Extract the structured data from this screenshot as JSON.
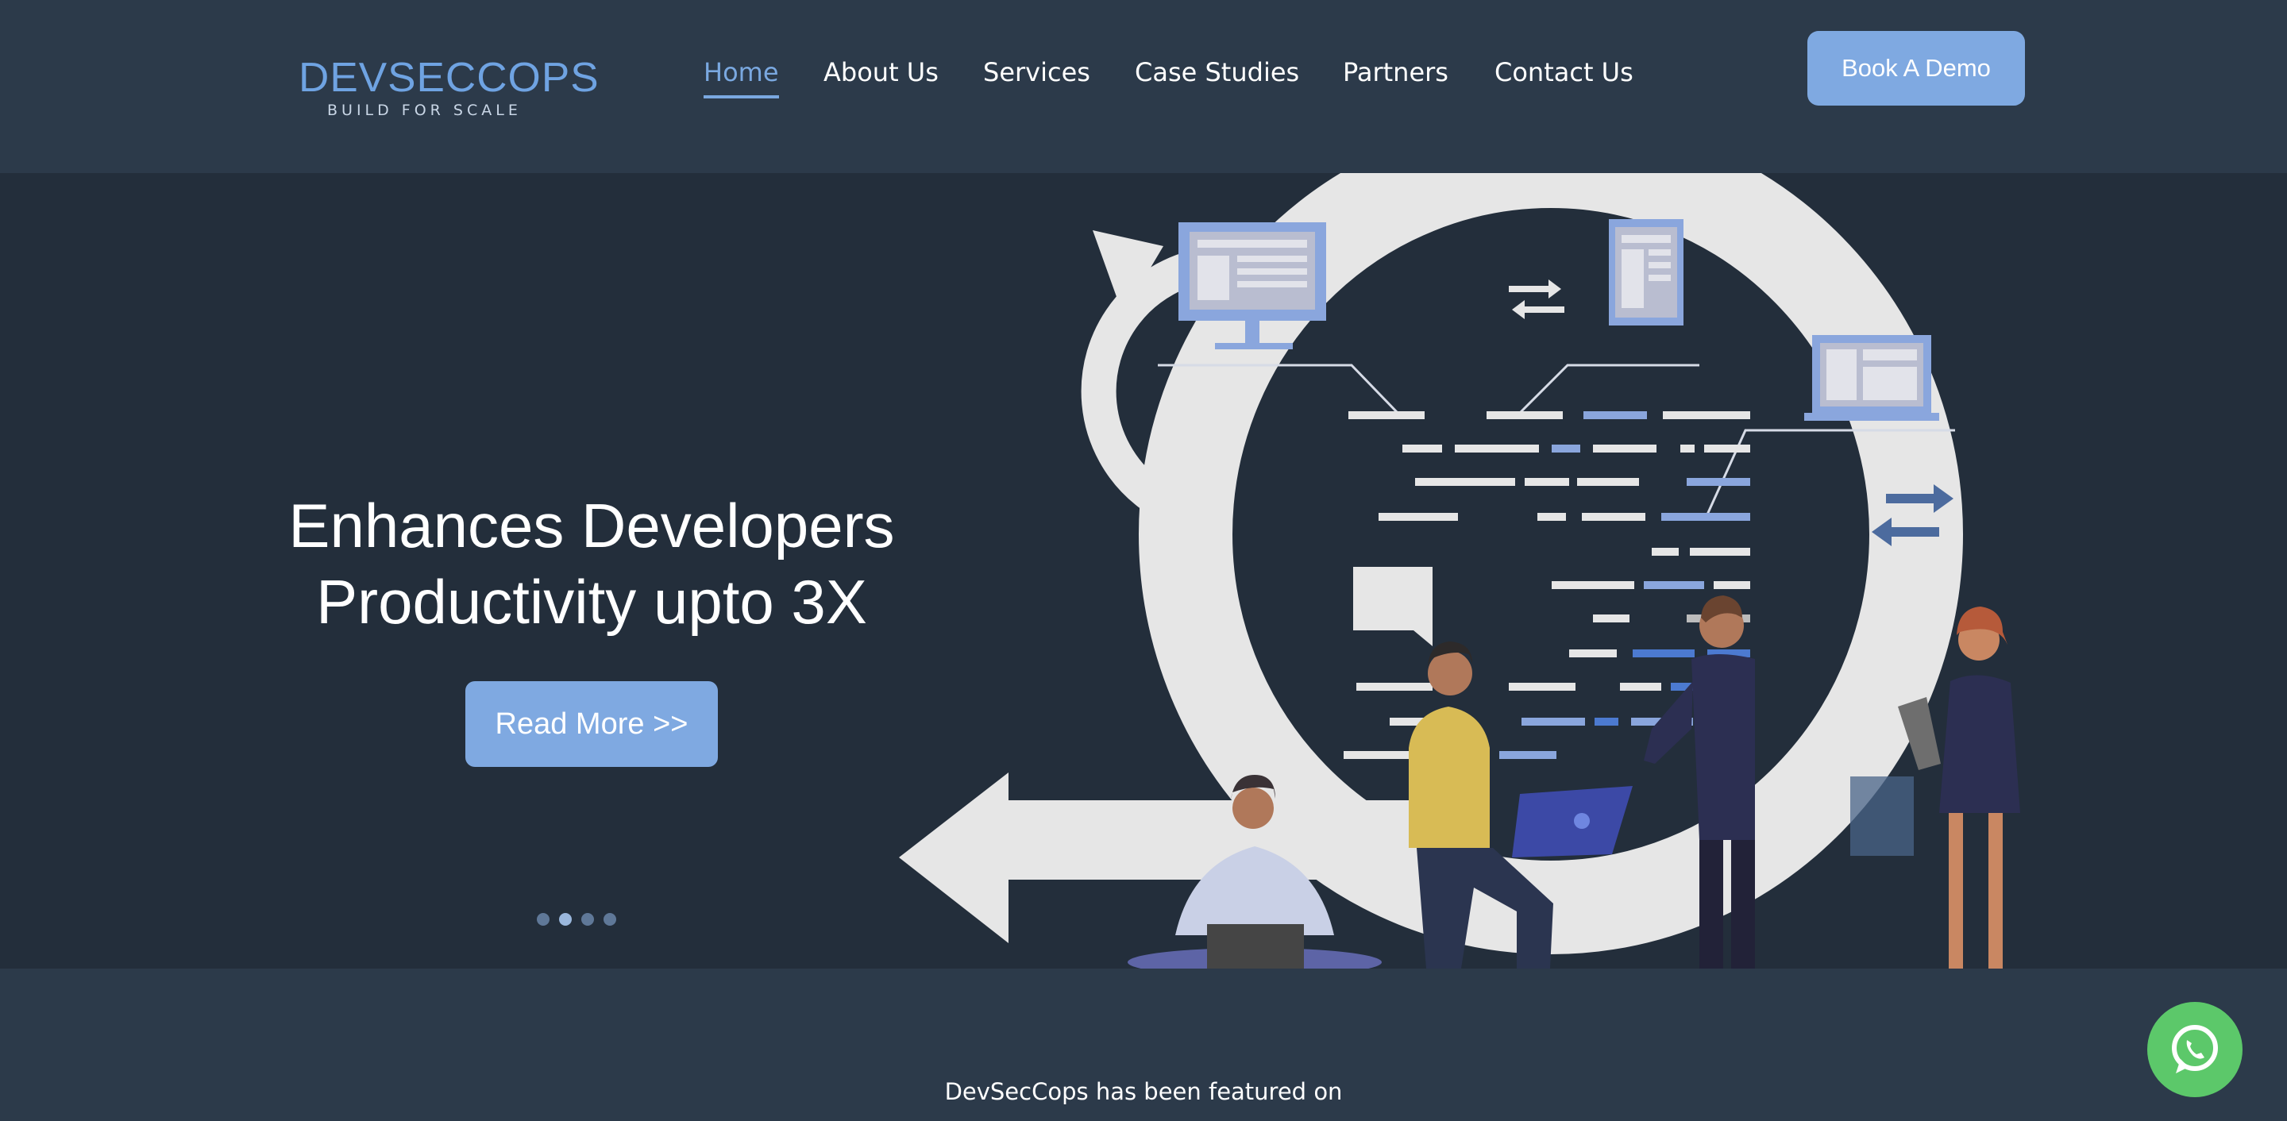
{
  "header": {
    "logo_text": "DEVSECCOPS",
    "logo_tagline": "BUILD FOR SCALE",
    "nav": [
      {
        "label": "Home",
        "active": true
      },
      {
        "label": "About Us",
        "active": false
      },
      {
        "label": "Services",
        "active": false
      },
      {
        "label": "Case Studies",
        "active": false
      },
      {
        "label": "Partners",
        "active": false
      },
      {
        "label": "Contact Us",
        "active": false
      }
    ],
    "cta_label": "Book A Demo"
  },
  "hero": {
    "headline_line1": "Enhances Developers",
    "headline_line2": "Productivity upto 3X",
    "button_label": "Read More >>",
    "slides_total": 4,
    "slide_active": 2,
    "illustration": "devops-cycle-team-illustration"
  },
  "featured": {
    "text": "DevSecCops has been featured on"
  },
  "floating": {
    "whatsapp_icon": "whatsapp-icon"
  },
  "colors": {
    "accent": "#7fa9e1",
    "header_bg": "#2c3a4a",
    "hero_bg": "#232e3b",
    "whatsapp": "#5cc86a"
  }
}
